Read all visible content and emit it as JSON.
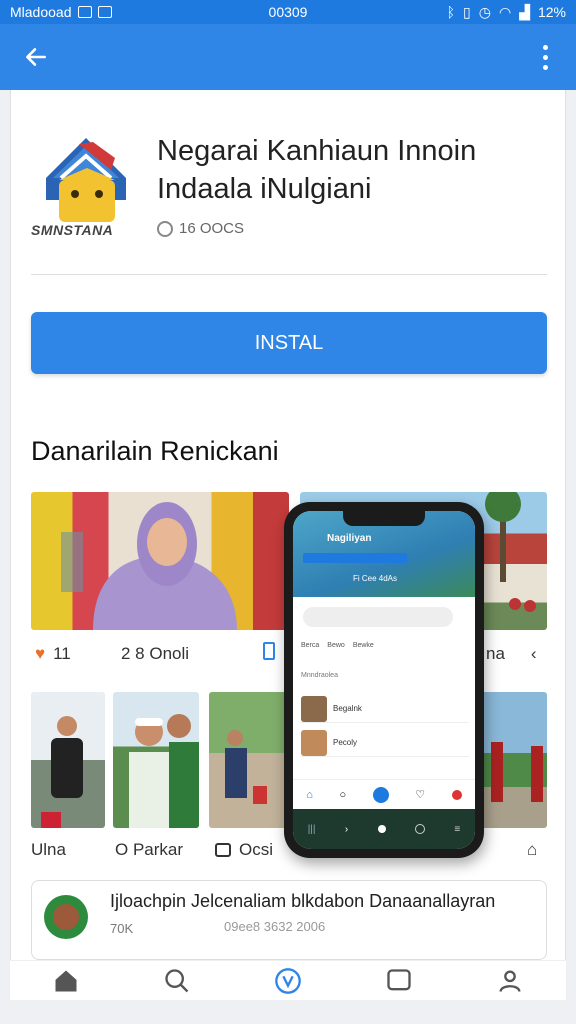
{
  "status_bar": {
    "left_text": "Mladooad",
    "center_text": "00309",
    "battery": "12%"
  },
  "app": {
    "title": "Negarai Kanhiaun Innoin Indaala iNulgiani",
    "developer": "SMNSTANA",
    "downloads": "16 OOCS",
    "install_label": "INSTAL"
  },
  "screenshots_section": {
    "title": "Danarilain Renickani",
    "row1_captions": [
      {
        "icon": "heart-icon",
        "text": "11"
      },
      {
        "icon": "",
        "text": "2 8 Onoli"
      },
      {
        "icon": "phone-icon",
        "text": ""
      },
      {
        "icon": "",
        "text": "na"
      }
    ],
    "row2_captions": [
      {
        "text": "Ulna"
      },
      {
        "text": "O Parkar"
      },
      {
        "text": "Ocsi"
      },
      {
        "text": ""
      }
    ]
  },
  "phone_mock": {
    "title": "Nagiliyan",
    "subtitle": "Fi Cee 4dAs",
    "tabs": [
      "Berca",
      "Bewo",
      "Bewke"
    ],
    "field_placeholder": "Mnndraolea",
    "rows": [
      "Begalnk",
      "Pecoly"
    ]
  },
  "feature_card": {
    "title": "Ijloachpin Jelcenaliam blkdabon Danaanallayran",
    "subtitle": "70K",
    "date": "09ee8 3632 2006"
  },
  "colors": {
    "primary": "#2f86e6",
    "statusbar": "#1f7ae0",
    "accent_green": "#2e8b3e"
  }
}
